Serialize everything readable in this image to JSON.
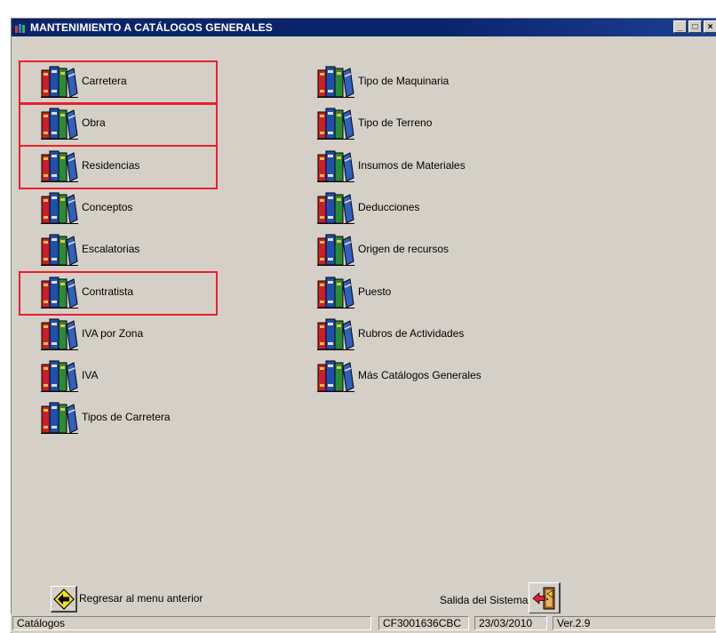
{
  "window": {
    "title": "MANTENIMIENTO A CATÁLOGOS GENERALES",
    "controls": {
      "minimize": "_",
      "maximize": "□",
      "close": "×"
    }
  },
  "catalog": {
    "left": [
      {
        "label": "Carretera",
        "highlighted": true
      },
      {
        "label": "Obra",
        "highlighted": true
      },
      {
        "label": "Residencias",
        "highlighted": true
      },
      {
        "label": "Conceptos",
        "highlighted": false
      },
      {
        "label": "Escalatorias",
        "highlighted": false
      },
      {
        "label": "Contratista",
        "highlighted": true
      },
      {
        "label": "IVA por Zona",
        "highlighted": false
      },
      {
        "label": "IVA",
        "highlighted": false
      },
      {
        "label": "Tipos de Carretera",
        "highlighted": false
      }
    ],
    "right": [
      {
        "label": "Tipo de Maquinaria"
      },
      {
        "label": "Tipo de Terreno"
      },
      {
        "label": "Insumos de Materiales"
      },
      {
        "label": "Deducciones"
      },
      {
        "label": "Origen de recursos"
      },
      {
        "label": "Puesto"
      },
      {
        "label": "Rubros de Actividades"
      },
      {
        "label": "Más Catálogos Generales"
      }
    ],
    "icon": "books-icon"
  },
  "footer": {
    "back_label": "Regresar al menu anterior",
    "exit_label": "Salida del Sistema"
  },
  "statusbar": {
    "section": "Catálogos",
    "user": "CF3001636CBC",
    "date": "23/03/2010",
    "version": "Ver.2.9"
  },
  "colors": {
    "titlebar": "#0a246a",
    "window_bg": "#d4d0c8",
    "highlight": "#e8202a"
  }
}
